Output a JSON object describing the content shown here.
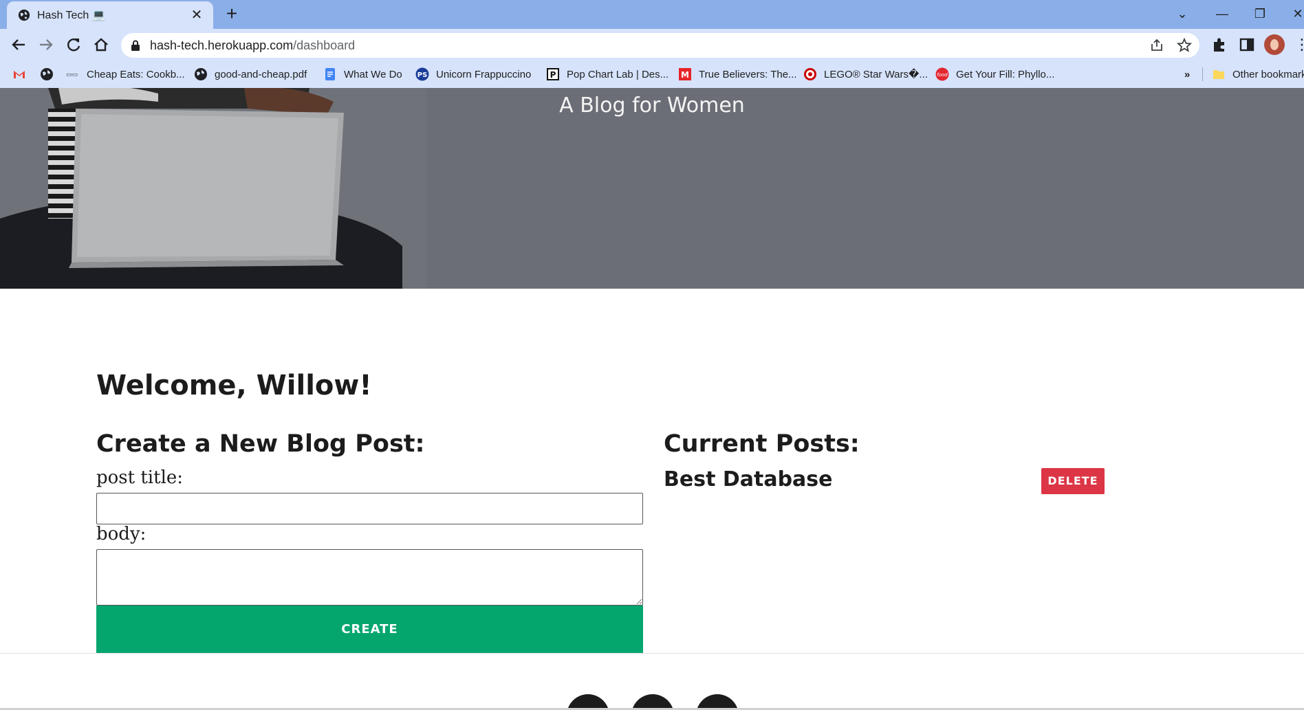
{
  "browser": {
    "tab": {
      "title": "Hash Tech 💻"
    },
    "url": {
      "host": "hash-tech.herokuapp.com",
      "path": "/dashboard"
    },
    "bookmarks": [
      {
        "label": "",
        "icon": "gmail-icon"
      },
      {
        "label": "",
        "icon": "globe-icon"
      },
      {
        "label": "Cheap Eats: Cookb...",
        "icon": "site-icon"
      },
      {
        "label": "good-and-cheap.pdf",
        "icon": "globe-icon"
      },
      {
        "label": "What We Do",
        "icon": "docs-icon"
      },
      {
        "label": "Unicorn Frappuccino",
        "icon": "ps-icon"
      },
      {
        "label": "Pop Chart Lab | Des...",
        "icon": "p-icon"
      },
      {
        "label": "True Believers: The...",
        "icon": "marvel-icon"
      },
      {
        "label": "LEGO® Star Wars�...",
        "icon": "target-icon"
      },
      {
        "label": "Get Your Fill: Phyllo...",
        "icon": "food-icon"
      }
    ],
    "overflow": "»",
    "other_bookmarks": "Other bookmarks"
  },
  "page": {
    "hero": {
      "tagline": "A Blog for Women"
    },
    "welcome": "Welcome, Willow!",
    "create": {
      "heading": "Create a New Blog Post:",
      "title_label": "post title:",
      "title_value": "",
      "body_label": "body:",
      "body_value": "",
      "button": "CREATE"
    },
    "current": {
      "heading": "Current Posts:",
      "posts": [
        {
          "title": "Best Database",
          "delete_label": "DELETE"
        }
      ]
    }
  },
  "colors": {
    "create": "#04a66e",
    "delete": "#dc3545",
    "hero": "#6b6e76",
    "chrome": "#d6e3fb"
  }
}
